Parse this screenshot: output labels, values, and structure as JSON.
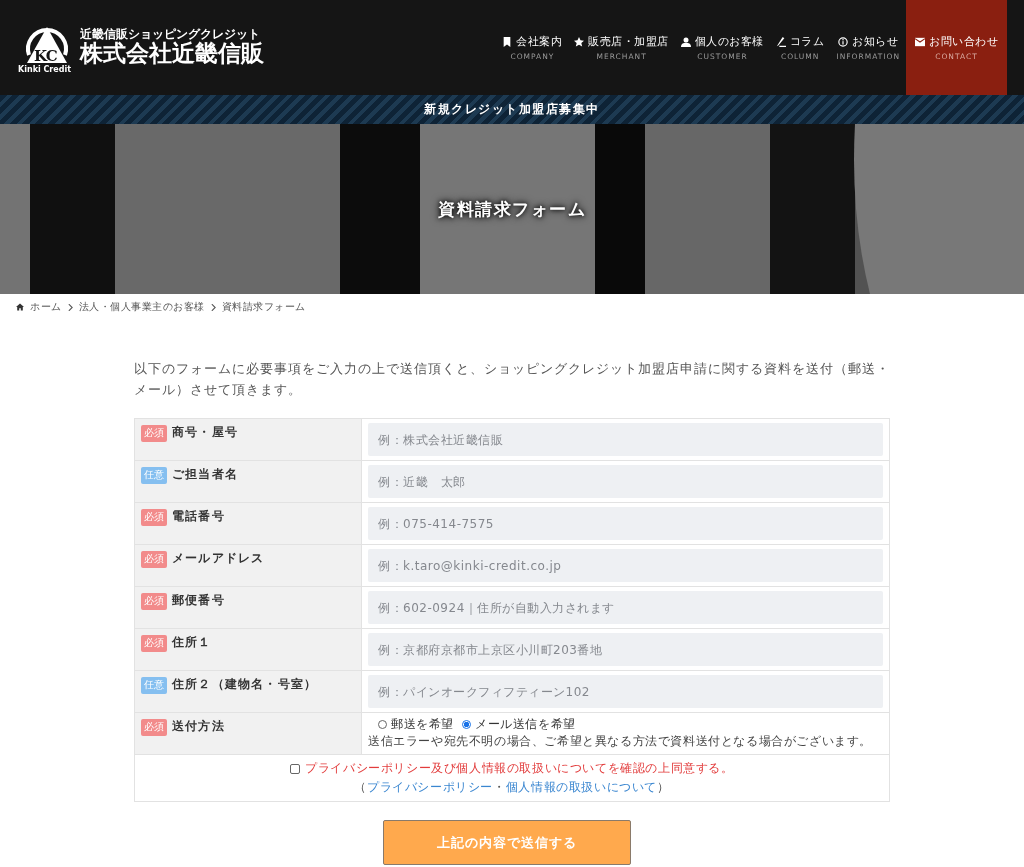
{
  "header": {
    "logo": {
      "mark_letters": "KC",
      "mark_caption": "Kinki Credit",
      "tagline": "近畿信販ショッピングクレジット",
      "company": "株式会社近畿信販"
    },
    "nav": [
      {
        "label": "会社案内",
        "sub": "COMPANY",
        "selected": false
      },
      {
        "label": "販売店・加盟店",
        "sub": "MERCHANT",
        "selected": false
      },
      {
        "label": "個人のお客様",
        "sub": "CUSTOMER",
        "selected": false
      },
      {
        "label": "コラム",
        "sub": "COLUMN",
        "selected": false
      },
      {
        "label": "お知らせ",
        "sub": "INFORMATION",
        "selected": false
      },
      {
        "label": "お問い合わせ",
        "sub": "CONTACT",
        "selected": true
      }
    ]
  },
  "banner": "新規クレジット加盟店募集中",
  "hero": {
    "kind": "picture",
    "title": "資料請求フォーム"
  },
  "breadcrumb": [
    "ホーム",
    "法人・個人事業主のお客様",
    "資料請求フォーム"
  ],
  "intro": "以下のフォームに必要事項をご入力の上で送信頂くと、ショッピングクレジット加盟店申請に関する資料を送付（郵送・メール）させて頂きます。",
  "fields": [
    {
      "kind": "required",
      "badge": "必須",
      "label": "商号・屋号",
      "placeholder": "例：株式会社近畿信販"
    },
    {
      "kind": "optional",
      "badge": "任意",
      "label": "ご担当者名",
      "placeholder": "例：近畿　太郎"
    },
    {
      "kind": "required",
      "badge": "必須",
      "label": "電話番号",
      "placeholder": "例：075-414-7575"
    },
    {
      "kind": "required",
      "badge": "必須",
      "label": "メールアドレス",
      "placeholder": "例：k.taro@kinki-credit.co.jp"
    },
    {
      "kind": "required",
      "badge": "必須",
      "label": "郵便番号",
      "placeholder": "例：602-0924｜住所が自動入力されます"
    },
    {
      "kind": "required",
      "badge": "必須",
      "label": "住所１",
      "placeholder": "例：京都府京都市上京区小川町203番地"
    },
    {
      "kind": "optional",
      "badge": "任意",
      "label": "住所２（建物名・号室）",
      "placeholder": "例：パインオークフィフティーン102"
    }
  ],
  "send_method": {
    "kind": "required",
    "badge": "必須",
    "label": "送付方法",
    "options": [
      {
        "label": "郵送を希望",
        "selected": false
      },
      {
        "label": "メール送信を希望",
        "selected": true
      }
    ],
    "note": "送信エラーや宛先不明の場合、ご希望と異なる方法で資料送付となる場合がございます。"
  },
  "consent": {
    "checked": false,
    "label": "プライバシーポリシー及び個人情報の取扱いについてを確認の上同意する。",
    "open": "（",
    "links": [
      "プライバシーポリシー",
      "個人情報の取扱いについて"
    ],
    "separator": "・",
    "close": "）"
  },
  "submit": "上記の内容で送信する"
}
